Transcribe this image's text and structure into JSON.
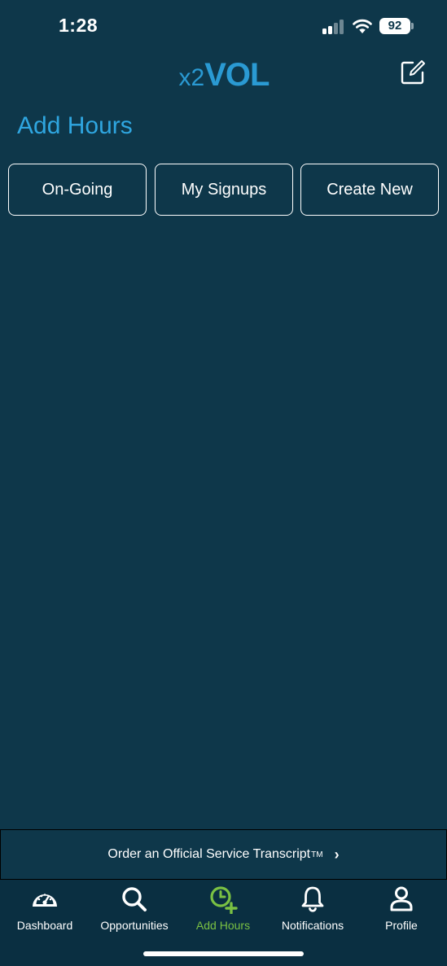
{
  "status_bar": {
    "time": "1:28",
    "battery_level": "92",
    "icons": [
      "cellular-signal-icon",
      "wifi-icon",
      "battery-icon"
    ]
  },
  "header": {
    "logo_prefix": "x2",
    "logo_main": "VOL",
    "edit_icon": "compose-icon"
  },
  "page": {
    "title": "Add Hours"
  },
  "tabs": [
    {
      "label": "On-Going"
    },
    {
      "label": "My Signups"
    },
    {
      "label": "Create New"
    }
  ],
  "transcript_banner": {
    "label": "Order an Official Service Transcript",
    "trademark": "TM",
    "chevron": "›"
  },
  "tabbar": {
    "items": [
      {
        "label": "Dashboard",
        "icon": "gauge-icon"
      },
      {
        "label": "Opportunities",
        "icon": "search-icon"
      },
      {
        "label": "Add Hours",
        "icon": "clock-plus-icon",
        "active": true
      },
      {
        "label": "Notifications",
        "icon": "bell-icon"
      },
      {
        "label": "Profile",
        "icon": "person-icon"
      }
    ]
  },
  "colors": {
    "background": "#0e374a",
    "tabbar_background": "#0a2f41",
    "title_blue": "#2fa6e0",
    "logo_blue": "#2a9ad3",
    "active_green": "#7ac143",
    "text": "#ffffff"
  }
}
